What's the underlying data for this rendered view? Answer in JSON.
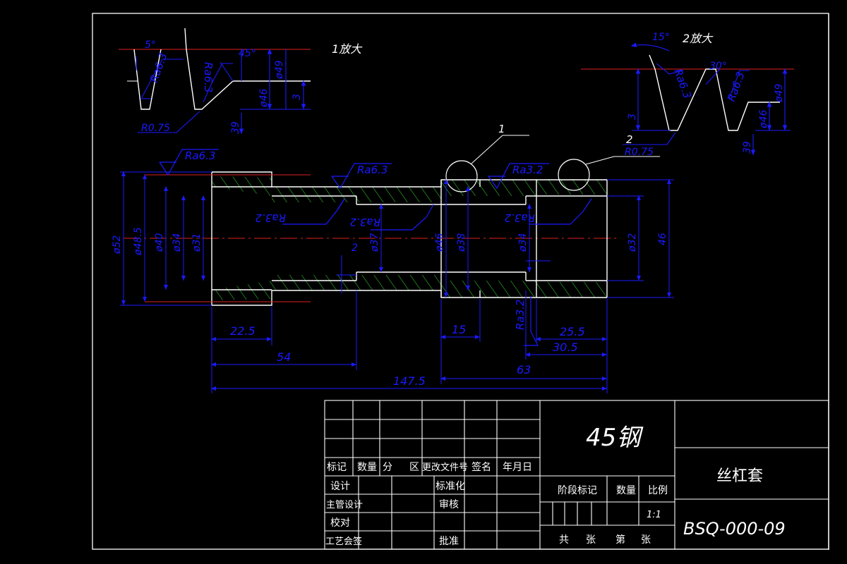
{
  "views": {
    "detail1_label": "1放大",
    "detail2_label": "2放大",
    "callout_1": "1",
    "callout_2": "2"
  },
  "detail1": {
    "angle_a": "5°",
    "angle_b": "45°",
    "ra_left": "Ra6.3",
    "ra_right": "Ra6.3",
    "dia_49": "ø49",
    "dia_46": "ø46",
    "dim_3": "3",
    "dim_39": "39",
    "radius": "R0.75"
  },
  "detail2": {
    "angle_a": "15°",
    "angle_b": "30°",
    "ra_left": "Ra6.3",
    "ra_right": "Ra6.3",
    "dia_49": "ø49",
    "dia_46": "ø46",
    "dim_3": "3",
    "dim_39": "39",
    "radius": "R0.75"
  },
  "main_view": {
    "ra_top_left": "Ra6.3",
    "ra_top_mid": "Ra6.3",
    "ra_top_right": "Ra3.2",
    "ra_in_left": "Ra3.2",
    "ra_in_mid": "Ra3.2",
    "ra_in_right": "Ra3.2",
    "ra_bottom": "Ra3.2",
    "dia_52": "ø52",
    "dia_48_5": "ø48.5",
    "dia_40": "ø40",
    "dia_34_left": "ø34",
    "dia_31": "ø31",
    "dim_2": "2",
    "dia_37": "ø37",
    "dia_46": "ø46",
    "dia_38": "ø38",
    "dia_34_right": "ø34",
    "dia_32": "ø32",
    "dim_46": "46",
    "len_22_5": "22.5",
    "len_54": "54",
    "len_147_5": "147.5",
    "len_15": "15",
    "len_25_5": "25.5",
    "len_30_5": "30.5",
    "len_63": "63"
  },
  "title_block": {
    "material": "45钢",
    "part_name": "丝杠套",
    "drawing_no": "BSQ-000-09",
    "hdr_mark": "标记",
    "hdr_qty": "数量",
    "hdr_zone_fen": "分",
    "hdr_zone_qu": "区",
    "hdr_change_doc": "更改文件号",
    "hdr_sign": "签名",
    "hdr_date": "年月日",
    "row_design": "设计",
    "row_standard": "标准化",
    "row_chief": "主管设计",
    "row_review": "审核",
    "row_check": "校对",
    "row_process": "工艺会签",
    "row_approve": "批准",
    "stage_mark": "阶段标记",
    "weight": "数量",
    "scale_label": "比例",
    "scale_value": "1:1",
    "sheet_total": "共",
    "sheet_zhang1": "张",
    "sheet_no": "第",
    "sheet_zhang2": "张"
  },
  "colors": {
    "outline": "#ffffff",
    "dimension": "#1a1aff",
    "centerline": "#e02020",
    "hatch": "#2fbf2f"
  }
}
